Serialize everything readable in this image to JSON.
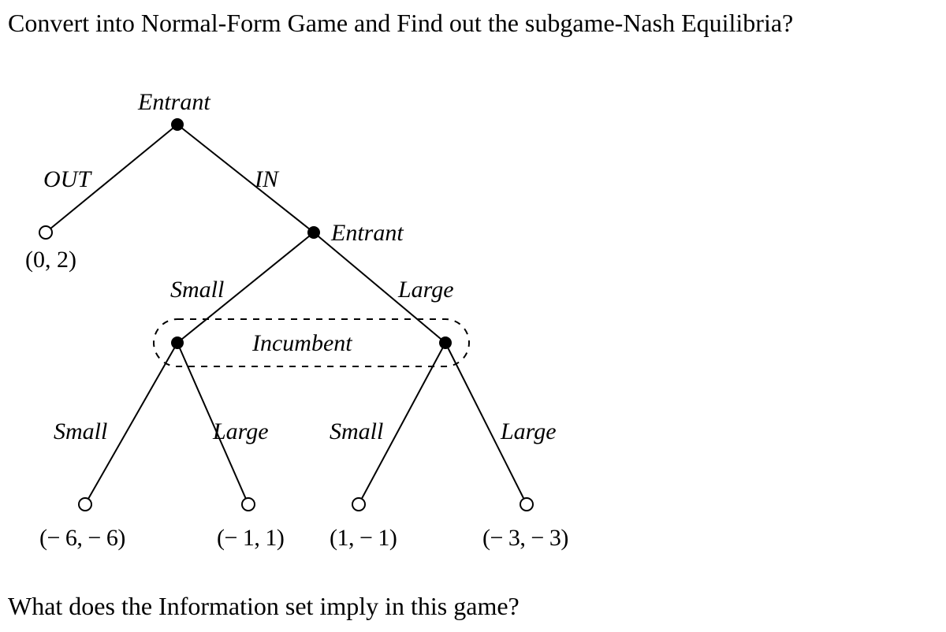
{
  "title": "Convert into Normal-Form Game and Find out the subgame-Nash Equilibria?",
  "footer_question": "What does the Information set imply in this game?",
  "players": {
    "root": "Entrant",
    "second": "Entrant",
    "infoset": "Incumbent"
  },
  "actions": {
    "out": "OUT",
    "in": "IN",
    "small": "Small",
    "large": "Large"
  },
  "payoffs": {
    "out": "(0, 2)",
    "ss": "(− 6, − 6)",
    "sl": "(− 1, 1)",
    "ls": "(1, − 1)",
    "ll": "(− 3, − 3)"
  },
  "chart_data": {
    "type": "game_tree",
    "players": [
      "Entrant",
      "Incumbent"
    ],
    "nodes": [
      {
        "id": "n0",
        "player": "Entrant",
        "actions": [
          "OUT",
          "IN"
        ]
      },
      {
        "id": "n_out",
        "terminal": true,
        "payoff": [
          0,
          2
        ]
      },
      {
        "id": "n1",
        "player": "Entrant",
        "actions": [
          "Small",
          "Large"
        ]
      },
      {
        "id": "n_small",
        "player": "Incumbent",
        "actions": [
          "Small",
          "Large"
        ],
        "infoset": "I1"
      },
      {
        "id": "n_large",
        "player": "Incumbent",
        "actions": [
          "Small",
          "Large"
        ],
        "infoset": "I1"
      },
      {
        "id": "t_ss",
        "terminal": true,
        "payoff": [
          -6,
          -6
        ]
      },
      {
        "id": "t_sl",
        "terminal": true,
        "payoff": [
          -1,
          1
        ]
      },
      {
        "id": "t_ls",
        "terminal": true,
        "payoff": [
          1,
          -1
        ]
      },
      {
        "id": "t_ll",
        "terminal": true,
        "payoff": [
          -3,
          -3
        ]
      }
    ],
    "edges": [
      {
        "from": "n0",
        "action": "OUT",
        "to": "n_out"
      },
      {
        "from": "n0",
        "action": "IN",
        "to": "n1"
      },
      {
        "from": "n1",
        "action": "Small",
        "to": "n_small"
      },
      {
        "from": "n1",
        "action": "Large",
        "to": "n_large"
      },
      {
        "from": "n_small",
        "action": "Small",
        "to": "t_ss"
      },
      {
        "from": "n_small",
        "action": "Large",
        "to": "t_sl"
      },
      {
        "from": "n_large",
        "action": "Small",
        "to": "t_ls"
      },
      {
        "from": "n_large",
        "action": "Large",
        "to": "t_ll"
      }
    ],
    "information_sets": [
      {
        "id": "I1",
        "player": "Incumbent",
        "nodes": [
          "n_small",
          "n_large"
        ]
      }
    ]
  }
}
